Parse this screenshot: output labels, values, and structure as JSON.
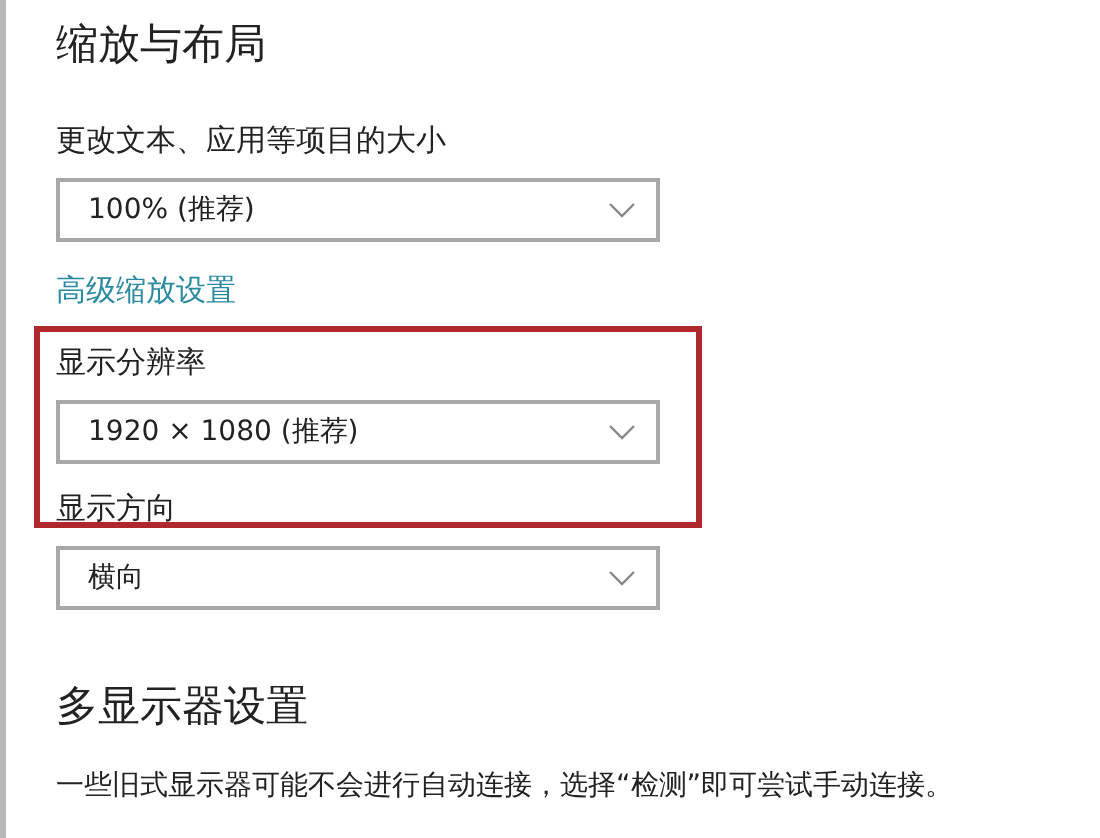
{
  "section_title": "缩放与布局",
  "settings": [
    {
      "label": "更改文本、应用等项目的大小",
      "value": "100% (推荐)",
      "highlighted": false
    },
    {
      "kind": "link",
      "text": "高级缩放设置"
    },
    {
      "label": "显示分辨率",
      "value": "1920 × 1080 (推荐)",
      "highlighted": true
    },
    {
      "label": "显示方向",
      "value": "横向",
      "highlighted": false
    }
  ],
  "multi_display": {
    "title": "多显示器设置",
    "description": "一些旧式显示器可能不会进行自动连接，选择“检测”即可尝试手动连接。"
  }
}
